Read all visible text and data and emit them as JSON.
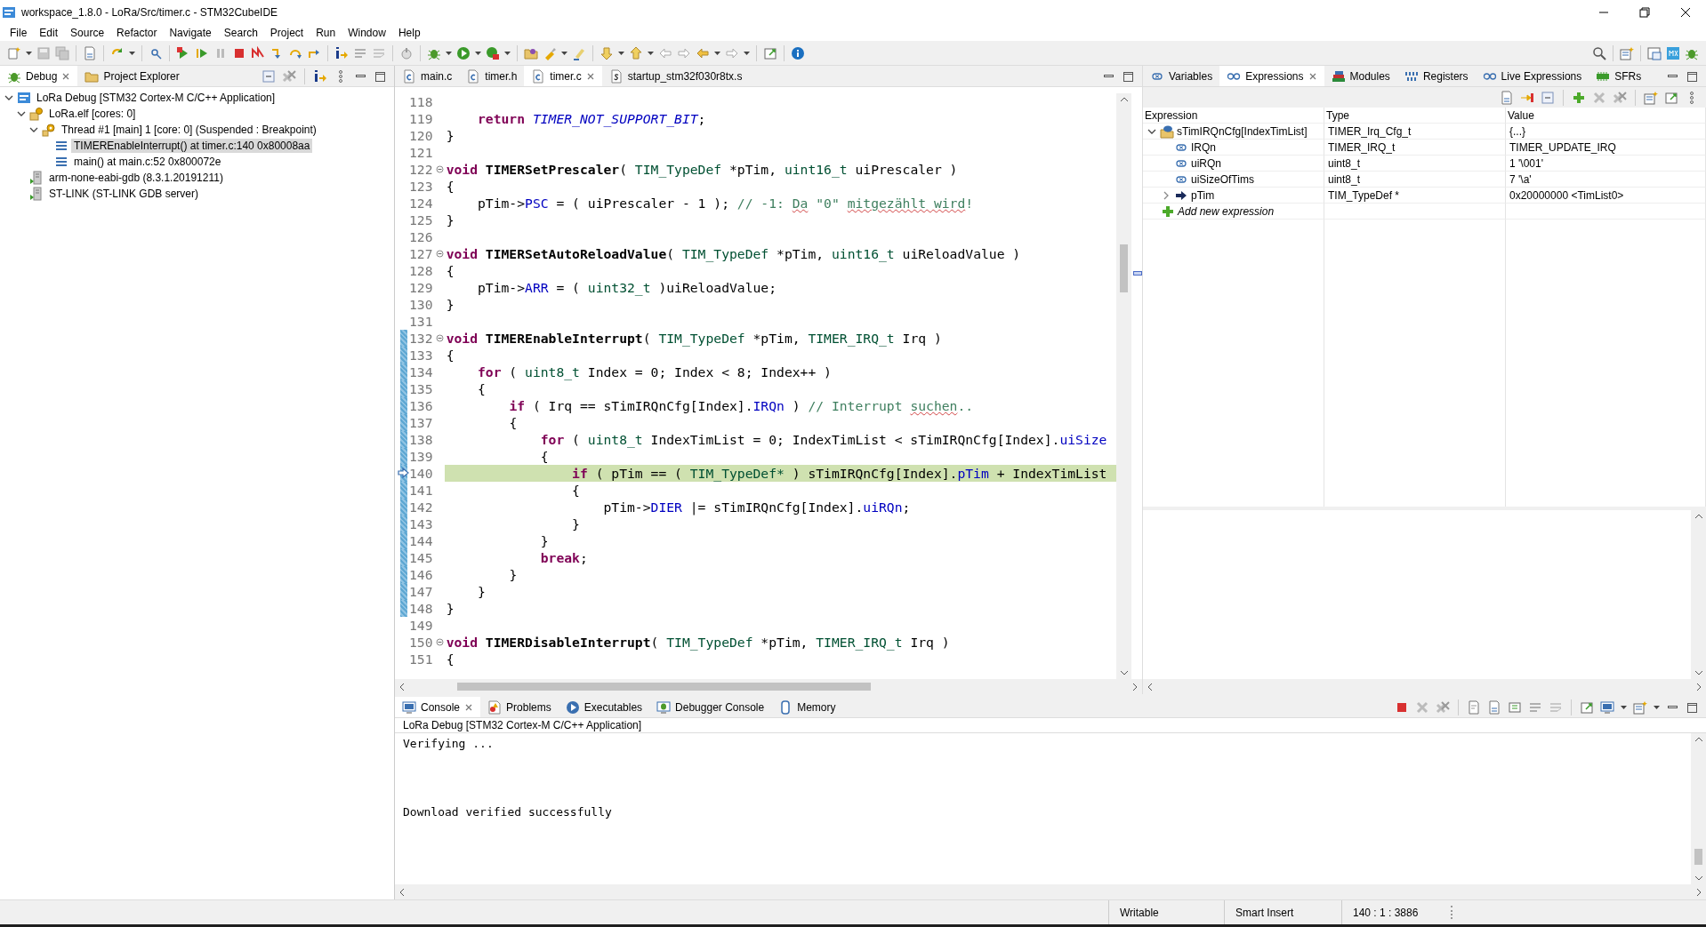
{
  "window": {
    "title": "workspace_1.8.0 - LoRa/Src/timer.c - STM32CubeIDE"
  },
  "menu": [
    "File",
    "Edit",
    "Source",
    "Refactor",
    "Navigate",
    "Search",
    "Project",
    "Run",
    "Window",
    "Help"
  ],
  "debug_view": {
    "tabs": [
      {
        "label": "Debug",
        "kind": "debug",
        "selected": true
      },
      {
        "label": "Project Explorer",
        "kind": "folder",
        "selected": false
      }
    ],
    "tree": [
      {
        "label": "LoRa Debug [STM32 Cortex-M C/C++ Application]",
        "kind": "launch",
        "expanded": true,
        "selected": false,
        "children": [
          {
            "label": "LoRa.elf [cores: 0]",
            "kind": "process",
            "expanded": true,
            "selected": false,
            "children": [
              {
                "label": "Thread #1 [main] 1 [core: 0] (Suspended : Breakpoint)",
                "kind": "thread",
                "expanded": true,
                "selected": false,
                "children": [
                  {
                    "label": "TIMEREnableInterrupt() at timer.c:140 0x80008aa",
                    "kind": "frame",
                    "selected": true
                  },
                  {
                    "label": "main() at main.c:52 0x800072e",
                    "kind": "frame",
                    "selected": false
                  }
                ]
              }
            ]
          },
          {
            "label": "arm-none-eabi-gdb (8.3.1.20191211)",
            "kind": "gdb",
            "selected": false
          },
          {
            "label": "ST-LINK (ST-LINK GDB server)",
            "kind": "gdb",
            "selected": false
          }
        ]
      }
    ]
  },
  "editor": {
    "tabs": [
      {
        "label": "main.c",
        "kind": "c-file",
        "selected": false
      },
      {
        "label": "timer.h",
        "kind": "c-file",
        "selected": false
      },
      {
        "label": "timer.c",
        "kind": "c-file",
        "selected": true
      },
      {
        "label": "startup_stm32f030r8tx.s",
        "kind": "asm-file",
        "selected": false
      }
    ],
    "lines": [
      {
        "number": "118",
        "foldable": false,
        "in_range": false,
        "current": false
      },
      {
        "number": "119",
        "foldable": false,
        "in_range": false,
        "current": false,
        "segments": [
          {
            "kind": "keyword",
            "text": "    return "
          },
          {
            "kind": "constant",
            "text": "TIMER_NOT_SUPPORT_BIT"
          },
          {
            "kind": "plain",
            "text": ";"
          }
        ]
      },
      {
        "number": "120",
        "foldable": false,
        "in_range": false,
        "current": false,
        "segments": [
          {
            "kind": "plain",
            "text": "}"
          }
        ]
      },
      {
        "number": "121",
        "foldable": false,
        "in_range": false,
        "current": false
      },
      {
        "number": "122",
        "foldable": true,
        "in_range": false,
        "current": false,
        "segments": [
          {
            "kind": "keyword",
            "text": "void "
          },
          {
            "kind": "function",
            "text": "TIMERSetPrescaler"
          },
          {
            "kind": "plain",
            "text": "( "
          },
          {
            "kind": "type",
            "text": "TIM_TypeDef"
          },
          {
            "kind": "plain",
            "text": " *pTim, "
          },
          {
            "kind": "type",
            "text": "uint16_t"
          },
          {
            "kind": "plain",
            "text": " uiPrescaler )"
          }
        ]
      },
      {
        "number": "123",
        "foldable": false,
        "in_range": false,
        "current": false,
        "segments": [
          {
            "kind": "plain",
            "text": "{"
          }
        ]
      },
      {
        "number": "124",
        "foldable": false,
        "in_range": false,
        "current": false,
        "segments": [
          {
            "kind": "plain",
            "text": "    pTim->"
          },
          {
            "kind": "field",
            "text": "PSC"
          },
          {
            "kind": "plain",
            "text": " = ( uiPrescaler - 1 ); "
          },
          {
            "kind": "comment",
            "text": "// -1: "
          },
          {
            "kind": "misspelled",
            "text": "Da"
          },
          {
            "kind": "comment",
            "text": " \"0\" "
          },
          {
            "kind": "misspelled",
            "text": "mitgezählt wird"
          },
          {
            "kind": "comment",
            "text": "!"
          }
        ]
      },
      {
        "number": "125",
        "foldable": false,
        "in_range": false,
        "current": false,
        "segments": [
          {
            "kind": "plain",
            "text": "}"
          }
        ]
      },
      {
        "number": "126",
        "foldable": false,
        "in_range": false,
        "current": false
      },
      {
        "number": "127",
        "foldable": true,
        "in_range": false,
        "current": false,
        "segments": [
          {
            "kind": "keyword",
            "text": "void "
          },
          {
            "kind": "function",
            "text": "TIMERSetAutoReloadValue"
          },
          {
            "kind": "plain",
            "text": "( "
          },
          {
            "kind": "type",
            "text": "TIM_TypeDef"
          },
          {
            "kind": "plain",
            "text": " *pTim, "
          },
          {
            "kind": "type",
            "text": "uint16_t"
          },
          {
            "kind": "plain",
            "text": " uiReloadValue )"
          }
        ]
      },
      {
        "number": "128",
        "foldable": false,
        "in_range": false,
        "current": false,
        "segments": [
          {
            "kind": "plain",
            "text": "{"
          }
        ]
      },
      {
        "number": "129",
        "foldable": false,
        "in_range": false,
        "current": false,
        "segments": [
          {
            "kind": "plain",
            "text": "    pTim->"
          },
          {
            "kind": "field",
            "text": "ARR"
          },
          {
            "kind": "plain",
            "text": " = ( "
          },
          {
            "kind": "type",
            "text": "uint32_t"
          },
          {
            "kind": "plain",
            "text": " )uiReloadValue;"
          }
        ]
      },
      {
        "number": "130",
        "foldable": false,
        "in_range": false,
        "current": false,
        "segments": [
          {
            "kind": "plain",
            "text": "}"
          }
        ]
      },
      {
        "number": "131",
        "foldable": false,
        "in_range": false,
        "current": false
      },
      {
        "number": "132",
        "foldable": true,
        "in_range": true,
        "current": false,
        "segments": [
          {
            "kind": "keyword",
            "text": "void "
          },
          {
            "kind": "function",
            "text": "TIMEREnableInterrupt"
          },
          {
            "kind": "plain",
            "text": "( "
          },
          {
            "kind": "type",
            "text": "TIM_TypeDef"
          },
          {
            "kind": "plain",
            "text": " *pTim, "
          },
          {
            "kind": "type",
            "text": "TIMER_IRQ_t"
          },
          {
            "kind": "plain",
            "text": " Irq )"
          }
        ]
      },
      {
        "number": "133",
        "foldable": false,
        "in_range": true,
        "current": false,
        "segments": [
          {
            "kind": "plain",
            "text": "{"
          }
        ]
      },
      {
        "number": "134",
        "foldable": false,
        "in_range": true,
        "current": false,
        "segments": [
          {
            "kind": "keyword",
            "text": "    for"
          },
          {
            "kind": "plain",
            "text": " ( "
          },
          {
            "kind": "type",
            "text": "uint8_t"
          },
          {
            "kind": "plain",
            "text": " Index = 0; Index < 8; Index++ )"
          }
        ]
      },
      {
        "number": "135",
        "foldable": false,
        "in_range": true,
        "current": false,
        "segments": [
          {
            "kind": "plain",
            "text": "    {"
          }
        ]
      },
      {
        "number": "136",
        "foldable": false,
        "in_range": true,
        "current": false,
        "segments": [
          {
            "kind": "keyword",
            "text": "        if"
          },
          {
            "kind": "plain",
            "text": " ( Irq == sTimIRQnCfg[Index]."
          },
          {
            "kind": "field",
            "text": "IRQn"
          },
          {
            "kind": "plain",
            "text": " ) "
          },
          {
            "kind": "comment",
            "text": "// Interrupt "
          },
          {
            "kind": "misspelled",
            "text": "suchen"
          },
          {
            "kind": "comment",
            "text": ".."
          }
        ]
      },
      {
        "number": "137",
        "foldable": false,
        "in_range": true,
        "current": false,
        "segments": [
          {
            "kind": "plain",
            "text": "        {"
          }
        ]
      },
      {
        "number": "138",
        "foldable": false,
        "in_range": true,
        "current": false,
        "segments": [
          {
            "kind": "keyword",
            "text": "            for"
          },
          {
            "kind": "plain",
            "text": " ( "
          },
          {
            "kind": "type",
            "text": "uint8_t"
          },
          {
            "kind": "plain",
            "text": " IndexTimList = 0; IndexTimList < sTimIRQnCfg[Index]."
          },
          {
            "kind": "field",
            "text": "uiSize"
          }
        ]
      },
      {
        "number": "139",
        "foldable": false,
        "in_range": true,
        "current": false,
        "segments": [
          {
            "kind": "plain",
            "text": "            {"
          }
        ]
      },
      {
        "number": "140",
        "foldable": false,
        "in_range": true,
        "current": true,
        "segments": [
          {
            "kind": "keyword",
            "text": "                if"
          },
          {
            "kind": "plain",
            "text": " ( pTim == ( "
          },
          {
            "kind": "type",
            "text": "TIM_TypeDef*"
          },
          {
            "kind": "plain",
            "text": " ) sTimIRQnCfg[Index]."
          },
          {
            "kind": "field",
            "text": "pTim"
          },
          {
            "kind": "plain",
            "text": " + IndexTimList"
          }
        ]
      },
      {
        "number": "141",
        "foldable": false,
        "in_range": true,
        "current": false,
        "segments": [
          {
            "kind": "plain",
            "text": "                {"
          }
        ]
      },
      {
        "number": "142",
        "foldable": false,
        "in_range": true,
        "current": false,
        "segments": [
          {
            "kind": "plain",
            "text": "                    pTim->"
          },
          {
            "kind": "field",
            "text": "DIER"
          },
          {
            "kind": "plain",
            "text": " |= sTimIRQnCfg[Index]."
          },
          {
            "kind": "field",
            "text": "uiRQn"
          },
          {
            "kind": "plain",
            "text": ";"
          }
        ]
      },
      {
        "number": "143",
        "foldable": false,
        "in_range": true,
        "current": false,
        "segments": [
          {
            "kind": "plain",
            "text": "                }"
          }
        ]
      },
      {
        "number": "144",
        "foldable": false,
        "in_range": true,
        "current": false,
        "segments": [
          {
            "kind": "plain",
            "text": "            }"
          }
        ]
      },
      {
        "number": "145",
        "foldable": false,
        "in_range": true,
        "current": false,
        "segments": [
          {
            "kind": "keyword",
            "text": "            break"
          },
          {
            "kind": "plain",
            "text": ";"
          }
        ]
      },
      {
        "number": "146",
        "foldable": false,
        "in_range": true,
        "current": false,
        "segments": [
          {
            "kind": "plain",
            "text": "        }"
          }
        ]
      },
      {
        "number": "147",
        "foldable": false,
        "in_range": true,
        "current": false,
        "segments": [
          {
            "kind": "plain",
            "text": "    }"
          }
        ]
      },
      {
        "number": "148",
        "foldable": false,
        "in_range": true,
        "current": false,
        "segments": [
          {
            "kind": "plain",
            "text": "}"
          }
        ]
      },
      {
        "number": "149",
        "foldable": false,
        "in_range": false,
        "current": false
      },
      {
        "number": "150",
        "foldable": true,
        "in_range": false,
        "current": false,
        "segments": [
          {
            "kind": "keyword",
            "text": "void "
          },
          {
            "kind": "function",
            "text": "TIMERDisableInterrupt"
          },
          {
            "kind": "plain",
            "text": "( "
          },
          {
            "kind": "type",
            "text": "TIM_TypeDef"
          },
          {
            "kind": "plain",
            "text": " *pTim, "
          },
          {
            "kind": "type",
            "text": "TIMER_IRQ_t"
          },
          {
            "kind": "plain",
            "text": " Irq )"
          }
        ]
      },
      {
        "number": "151",
        "foldable": false,
        "in_range": false,
        "current": false,
        "segments": [
          {
            "kind": "plain",
            "text": "{"
          }
        ]
      }
    ]
  },
  "expressions_view": {
    "tabs": [
      {
        "label": "Variables",
        "kind": "variables",
        "selected": false
      },
      {
        "label": "Expressions",
        "kind": "expressions",
        "selected": true
      },
      {
        "label": "Modules",
        "kind": "modules",
        "selected": false
      },
      {
        "label": "Registers",
        "kind": "registers",
        "selected": false
      },
      {
        "label": "Live Expressions",
        "kind": "expressions",
        "selected": false
      },
      {
        "label": "SFRs",
        "kind": "sfr",
        "selected": false
      }
    ],
    "columns": [
      "Expression",
      "Type",
      "Value"
    ],
    "rows": [
      {
        "expression": "sTimIRQnCfg[IndexTimList]",
        "type": "TIMER_Irq_Cfg_t",
        "value": "{...}",
        "kind": "struct",
        "expanded": true,
        "children": [
          {
            "expression": "IRQn",
            "type": "TIMER_IRQ_t",
            "value": "TIMER_UPDATE_IRQ",
            "kind": "variable"
          },
          {
            "expression": "uiRQn",
            "type": "uint8_t",
            "value": "1 '\\001'",
            "kind": "variable"
          },
          {
            "expression": "uiSizeOfTims",
            "type": "uint8_t",
            "value": "7 '\\a'",
            "kind": "variable"
          },
          {
            "expression": "pTim",
            "type": "TIM_TypeDef *",
            "value": "0x20000000 <TimList0>",
            "kind": "pointer",
            "expanded": false
          }
        ]
      }
    ],
    "add_label": "Add new expression"
  },
  "console_view": {
    "tabs": [
      {
        "label": "Console",
        "kind": "console",
        "selected": true
      },
      {
        "label": "Problems",
        "kind": "problems",
        "selected": false
      },
      {
        "label": "Executables",
        "kind": "executables",
        "selected": false
      },
      {
        "label": "Debugger Console",
        "kind": "debugger-console",
        "selected": false
      },
      {
        "label": "Memory",
        "kind": "memory",
        "selected": false
      }
    ],
    "launch": "LoRa Debug [STM32 Cortex-M C/C++ Application]",
    "output": [
      "Verifying ...",
      "Download verified successfully"
    ]
  },
  "status_bar": [
    "Writable",
    "Smart Insert",
    "140 : 1 : 3886"
  ]
}
